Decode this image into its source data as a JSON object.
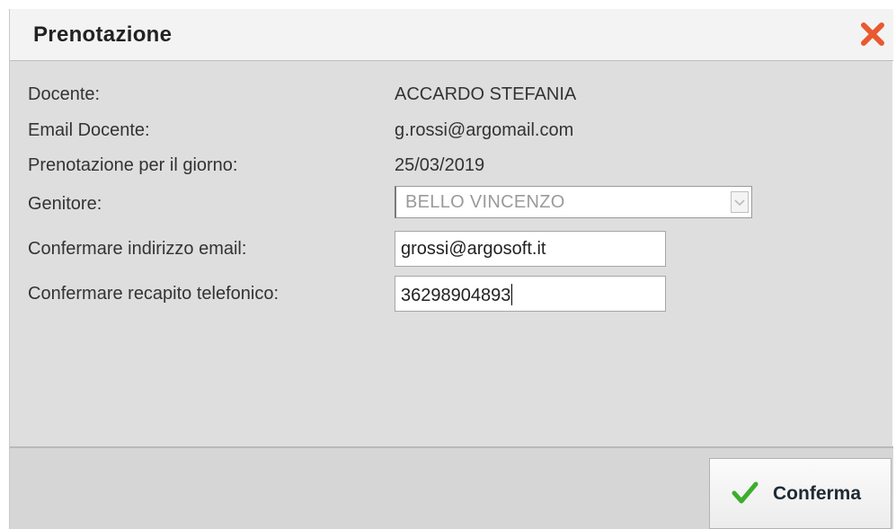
{
  "dialog": {
    "title": "Prenotazione",
    "close_icon": "close-x-icon",
    "accent_close_color": "#e8592e"
  },
  "fields": {
    "docente": {
      "label": "Docente:",
      "value": "ACCARDO STEFANIA"
    },
    "email_docente": {
      "label": "Email Docente:",
      "value": "g.rossi@argomail.com"
    },
    "giorno": {
      "label": "Prenotazione per il giorno:",
      "value": "25/03/2019"
    },
    "genitore": {
      "label": "Genitore:",
      "value": "BELLO VINCENZO",
      "disabled": true
    },
    "conferma_email": {
      "label": "Confermare indirizzo email:",
      "value": "grossi@argosoft.it"
    },
    "conferma_telefono": {
      "label": "Confermare recapito telefonico:",
      "value": "36298904893"
    }
  },
  "footer": {
    "confirm_label": "Conferma",
    "confirm_icon": "check-icon",
    "confirm_icon_color": "#3cae2c"
  }
}
